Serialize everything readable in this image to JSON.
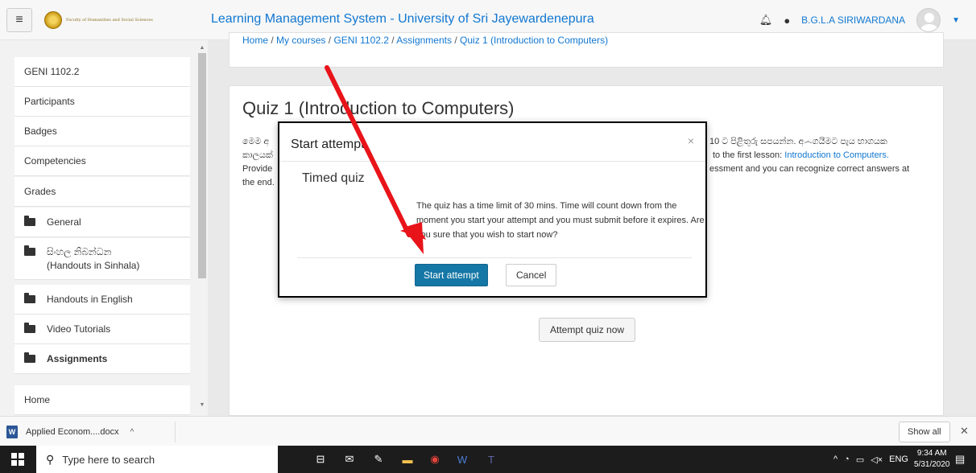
{
  "header": {
    "logo_text": "Faculty of Humanities and Social Sciences",
    "site_name": "Learning Management System - University of Sri Jayewardenepura",
    "user_name": "B.G.L.A SIRIWARDANA"
  },
  "drawer": {
    "items": [
      {
        "label": "GENI 1102.2"
      },
      {
        "label": "Participants"
      },
      {
        "label": "Badges"
      },
      {
        "label": "Competencies"
      },
      {
        "label": "Grades"
      },
      {
        "label": "General"
      },
      {
        "label": "සිංහල නිබන්ධන"
      },
      {
        "label": "(Handouts in Sinhala)"
      },
      {
        "label": "Handouts in English"
      },
      {
        "label": "Video Tutorials"
      },
      {
        "label": "Assignments"
      },
      {
        "label": "Home"
      }
    ]
  },
  "breadcrumb": [
    "Home",
    "My courses",
    "GENI 1102.2",
    "Assignments",
    "Quiz 1 (Introduction to Computers)"
  ],
  "main": {
    "title": "Quiz 1 (Introduction to Computers)",
    "intro_line1_left": "මෙම අ",
    "intro_line1_right": "10 ට පිළිතුරු සපයන්න. අ෴ගයීමට පැය භාගයක",
    "intro_line2_left": "කාලයක්",
    "intro_line2_right": "to the first lesson:",
    "intro_link": "Introduction to Computers.",
    "intro_line3_left": "Provide",
    "intro_line3_right": "essment and you can recognize correct answers at",
    "intro_line4_left": "the end.",
    "attempt_button": "Attempt quiz now"
  },
  "modal": {
    "title": "Start attempt",
    "close": "×",
    "subtitle": "Timed quiz",
    "body": "The quiz has a time limit of 30 mins. Time will count down from the moment you start your attempt and you must submit before it expires. Are you sure that you wish to start now?",
    "start_button": "Start attempt",
    "cancel_button": "Cancel"
  },
  "downloads": {
    "file_name": "Applied Econom....docx",
    "show_all": "Show all"
  },
  "taskbar": {
    "search_placeholder": "Type here to search",
    "lang": "ENG",
    "time": "9:34 AM",
    "date": "5/31/2020"
  }
}
